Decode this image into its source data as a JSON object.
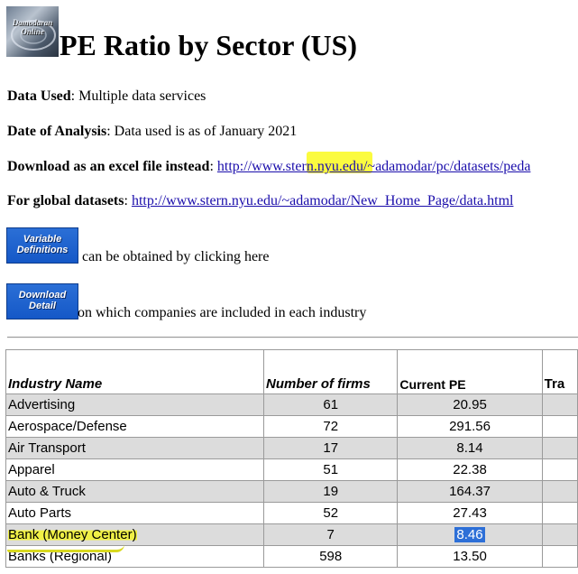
{
  "header": {
    "logo_text": "Damodaran Online",
    "title": "PE Ratio by Sector (US)"
  },
  "info": {
    "data_used_label": "Data Used",
    "data_used_value": ": Multiple data services",
    "date_label": "Date of Analysis",
    "date_value": ": Data used is as of January 2021",
    "download_label": "Download as an excel file instead",
    "download_sep": ": ",
    "download_link": "http://www.stern.nyu.edu/~adamodar/pc/datasets/peda",
    "global_label": "For global datasets",
    "global_sep": ": ",
    "global_link": "http://www.stern.nyu.edu/~adamodar/New_Home_Page/data.html"
  },
  "buttons": {
    "variable_definitions": "Variable Definitions",
    "variable_definitions_text": "can be obtained by clicking here",
    "download_detail": "Download Detail",
    "download_detail_text": "on which companies are included in each industry"
  },
  "table": {
    "headers": [
      "Industry Name",
      "Number of firms",
      "Current PE",
      "Tra"
    ],
    "rows": [
      {
        "name": "Advertising",
        "firms": "61",
        "pe": "20.95"
      },
      {
        "name": "Aerospace/Defense",
        "firms": "72",
        "pe": "291.56"
      },
      {
        "name": "Air Transport",
        "firms": "17",
        "pe": "8.14"
      },
      {
        "name": "Apparel",
        "firms": "51",
        "pe": "22.38"
      },
      {
        "name": "Auto & Truck",
        "firms": "19",
        "pe": "164.37"
      },
      {
        "name": "Auto Parts",
        "firms": "52",
        "pe": "27.43"
      },
      {
        "name": "Bank (Money Center)",
        "firms": "7",
        "pe": "8.46"
      },
      {
        "name": "Banks (Regional)",
        "firms": "598",
        "pe": "13.50"
      }
    ]
  },
  "colors": {
    "link": "#1a0dab",
    "row_shade": "#dcdcdc",
    "highlight_yellow": "#fbfb2a",
    "selection_blue": "#2d6fd7",
    "button_blue": "#1558c7"
  }
}
